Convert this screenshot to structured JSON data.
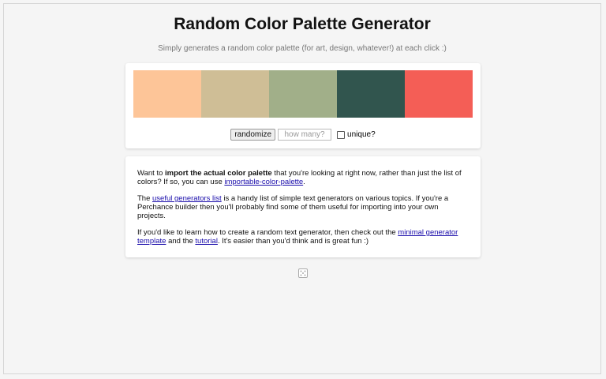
{
  "header": {
    "title": "Random Color Palette Generator",
    "subtitle": "Simply generates a random color palette (for art, design, whatever!) at each click :)"
  },
  "palette": {
    "colors": [
      "#FDC598",
      "#CFBE96",
      "#A1AF89",
      "#31554E",
      "#F45E56"
    ]
  },
  "controls": {
    "randomize_label": "randomize",
    "count_placeholder": "how many?",
    "count_value": "",
    "unique_label": "unique?",
    "unique_checked": false
  },
  "info": {
    "p1_pre": "Want to ",
    "p1_bold": "import the actual color palette",
    "p1_mid": " that you're looking at right now, rather than just the list of colors? If so, you can use ",
    "p1_link": "importable-color-palette",
    "p1_post": ".",
    "p2_pre": "The ",
    "p2_link": "useful generators list",
    "p2_post": " is a handy list of simple text generators on various topics. If you're a Perchance builder then you'll probably find some of them useful for importing into your own projects.",
    "p3_pre": "If you'd like to learn how to create a random text generator, then check out the ",
    "p3_link1": "minimal generator template",
    "p3_mid": " and the ",
    "p3_link2": "tutorial",
    "p3_post": ". It's easier than you'd think and is great fun :)"
  },
  "footer": {
    "icon": "dice-icon"
  }
}
